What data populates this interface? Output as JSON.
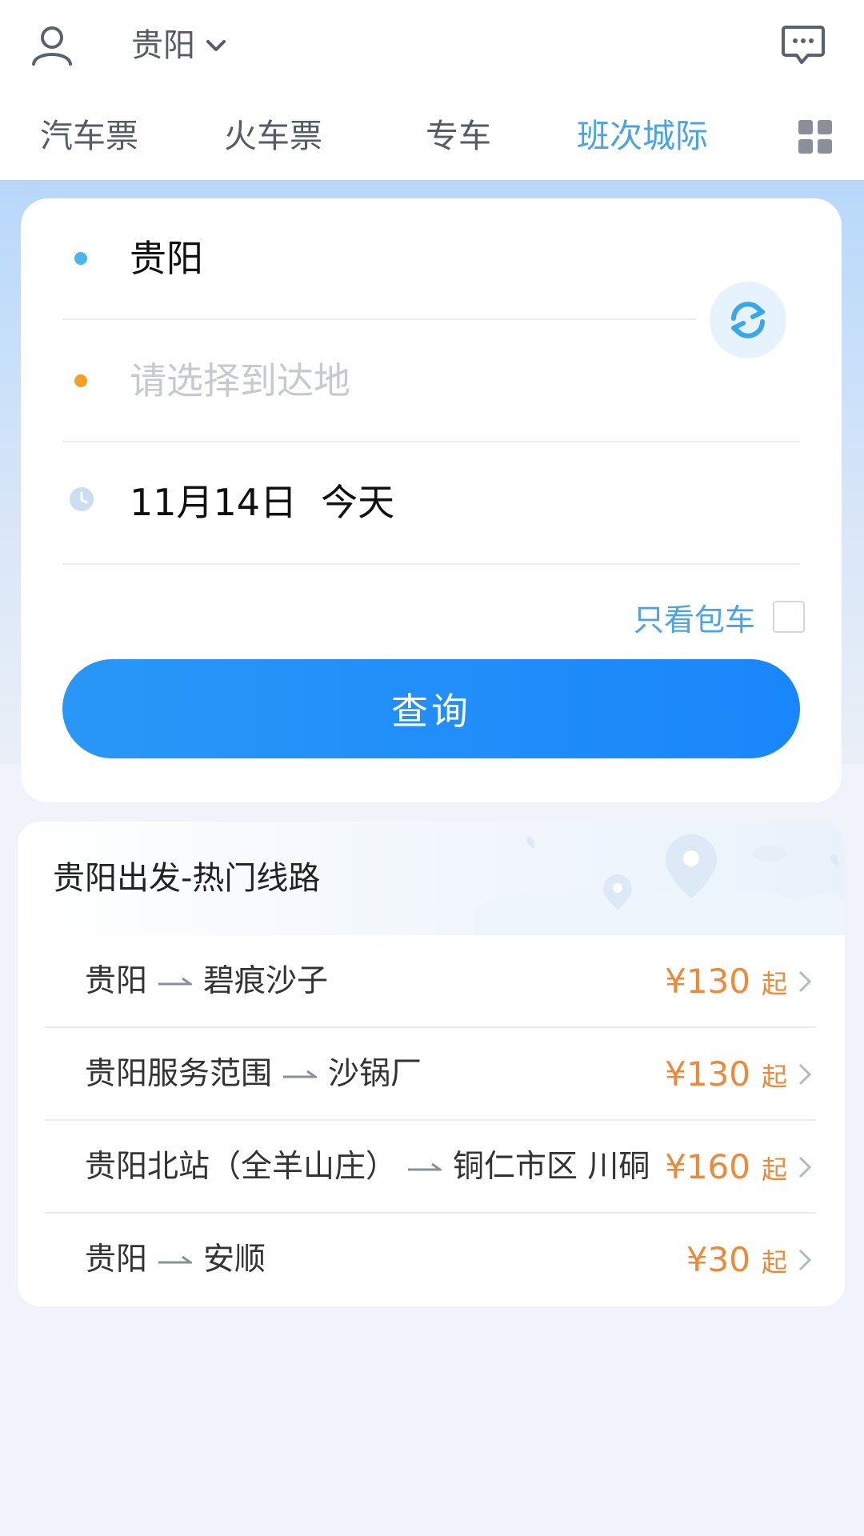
{
  "header": {
    "city": "贵阳",
    "icons": {
      "user": "user-icon",
      "city_dropdown": "chevron-down-icon",
      "message": "message-icon",
      "more": "grid-icon"
    }
  },
  "tabs": [
    {
      "label": "汽车票",
      "active": false
    },
    {
      "label": "火车票",
      "active": false
    },
    {
      "label": "专车",
      "active": false
    },
    {
      "label": "班次城际",
      "active": true
    }
  ],
  "search": {
    "origin": "贵阳",
    "destination_placeholder": "请选择到达地",
    "date": "11月14日",
    "date_day": "今天",
    "charter_only_label": "只看包车",
    "charter_only_checked": false,
    "query_button": "查询"
  },
  "routes": {
    "title": "贵阳出发-热门线路",
    "items": [
      {
        "from": "贵阳",
        "to": "碧痕沙子",
        "price": "¥130",
        "suffix": "起"
      },
      {
        "from": "贵阳服务范围",
        "to": "沙锅厂",
        "price": "¥130",
        "suffix": "起"
      },
      {
        "from": "贵阳北站（全羊山庄）",
        "to": "铜仁市区 川硐",
        "price": "¥160",
        "suffix": "起"
      },
      {
        "from": "贵阳",
        "to": "安顺",
        "price": "¥30",
        "suffix": "起"
      }
    ]
  },
  "colors": {
    "accent": "#4aa3e8",
    "button": "#1a86fb",
    "price": "#ec8a3a",
    "origin_dot": "#4ab6ef",
    "destination_dot": "#f5a023"
  }
}
